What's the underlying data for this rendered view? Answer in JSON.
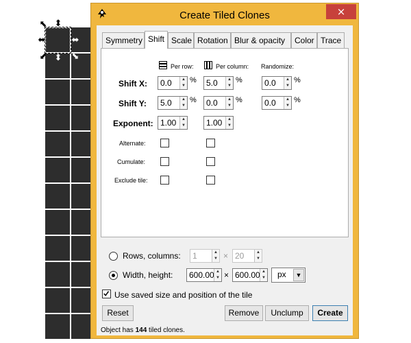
{
  "dialog": {
    "title": "Create Tiled Clones",
    "close_icon": "×"
  },
  "tabs": [
    {
      "label": "Symmetry"
    },
    {
      "label": "Shift"
    },
    {
      "label": "Scale"
    },
    {
      "label": "Rotation"
    },
    {
      "label": "Blur & opacity"
    },
    {
      "label": "Color"
    },
    {
      "label": "Trace"
    }
  ],
  "shift": {
    "col_headers": {
      "per_row": "Per row:",
      "per_column": "Per column:",
      "randomize": "Randomize:"
    },
    "shift_x": {
      "label": "Shift X:",
      "per_row": "0.0",
      "per_column": "5.0",
      "randomize": "0.0"
    },
    "shift_y": {
      "label": "Shift Y:",
      "per_row": "5.0",
      "per_column": "0.0",
      "randomize": "0.0"
    },
    "exponent": {
      "label": "Exponent:",
      "per_row": "1.00",
      "per_column": "1.00"
    },
    "percent": "%",
    "alternate": "Alternate:",
    "cumulate": "Cumulate:",
    "exclude_tile": "Exclude tile:"
  },
  "size": {
    "rows_columns_label": "Rows, columns:",
    "rows": "1",
    "columns": "20",
    "width_height_label": "Width, height:",
    "width": "600.00",
    "height": "600.00",
    "times": "×",
    "unit": "px",
    "selected_option": "width_height"
  },
  "use_saved_label": "Use saved size and position of the tile",
  "buttons": {
    "reset": "Reset",
    "remove": "Remove",
    "unclump": "Unclump",
    "create": "Create"
  },
  "status": {
    "prefix": "Object has ",
    "count": "144",
    "suffix": " tiled clones."
  }
}
